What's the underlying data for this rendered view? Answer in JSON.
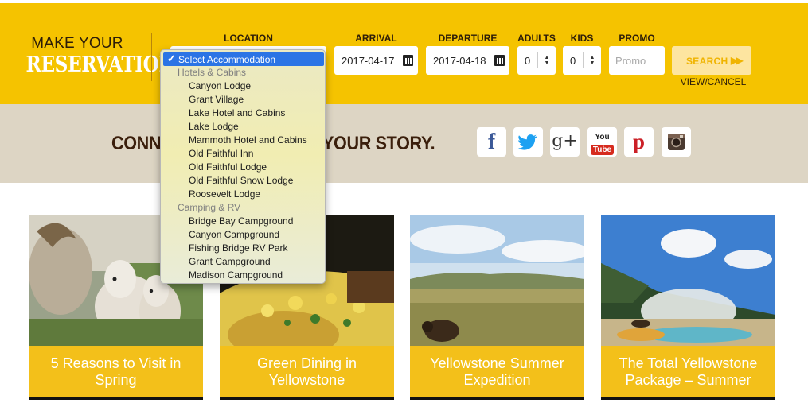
{
  "brand": {
    "line1": "MAKE YOUR",
    "line2": "RESERVATION"
  },
  "booking": {
    "location_label": "LOCATION",
    "arrival_label": "ARRIVAL",
    "arrival_value": "2017-04-17",
    "departure_label": "DEPARTURE",
    "departure_value": "2017-04-18",
    "adults_label": "ADULTS",
    "adults_value": "0",
    "kids_label": "KIDS",
    "kids_value": "0",
    "promo_label": "PROMO",
    "promo_placeholder": "Promo",
    "search_label": "SEARCH",
    "view_cancel_label": "VIEW/CANCEL"
  },
  "location_dropdown": {
    "selected": "Select Accommodation",
    "groups": [
      {
        "label": "Hotels & Cabins",
        "options": [
          "Canyon Lodge",
          "Grant Village",
          "Lake Hotel and Cabins",
          "Lake Lodge",
          "Mammoth Hotel and Cabins",
          "Old Faithful Inn",
          "Old Faithful Lodge",
          "Old Faithful Snow Lodge",
          "Roosevelt Lodge"
        ]
      },
      {
        "label": "Camping & RV",
        "options": [
          "Bridge Bay Campground",
          "Canyon Campground",
          "Fishing Bridge RV Park",
          "Grant Campground",
          "Madison Campground"
        ]
      }
    ]
  },
  "social": {
    "title_left": "CONN",
    "title_right": "RE YOUR STORY.",
    "icons": [
      "facebook-icon",
      "twitter-icon",
      "google-plus-icon",
      "youtube-icon",
      "pinterest-icon",
      "instagram-icon"
    ],
    "google_plus_text": "g+",
    "youtube_text_top": "You",
    "youtube_text_bottom": "Tube"
  },
  "cards": [
    {
      "title": "5 Reasons to Visit in Spring"
    },
    {
      "title": "Green Dining in Yellowstone"
    },
    {
      "title": "Yellowstone Summer Expedition"
    },
    {
      "title": "The Total Yellowstone Package – Summer"
    }
  ],
  "colors": {
    "brand_yellow": "#f5c300",
    "caption_yellow": "#f3c01a",
    "dark_brown": "#2d1d08",
    "band_tan": "#ddd5c4",
    "selection_blue": "#2b74e5",
    "facebook": "#3b5998",
    "twitter": "#1da1f2",
    "youtube_red": "#d62b1e",
    "pinterest_red": "#cb2027"
  }
}
